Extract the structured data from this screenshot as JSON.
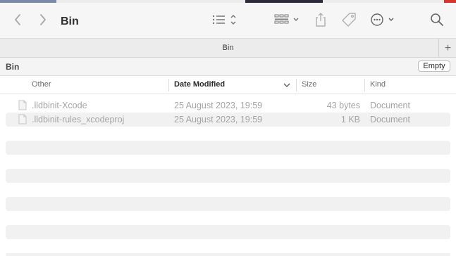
{
  "window": {
    "title": "Bin"
  },
  "tabbar": {
    "tab_label": "Bin",
    "new_tab": "+"
  },
  "pathbar": {
    "label": "Bin",
    "empty_button": "Empty"
  },
  "columns": {
    "name": "Other",
    "date": "Date Modified",
    "size": "Size",
    "kind": "Kind"
  },
  "files": [
    {
      "name": ".lldbinit-Xcode",
      "date": "25 August 2023, 19:59",
      "size": "43 bytes",
      "kind": "Document"
    },
    {
      "name": ".lldbinit-rules_xcodeproj",
      "date": "25 August 2023, 19:59",
      "size": "1 KB",
      "kind": "Document"
    }
  ],
  "icons": {
    "back": "chevron-left-icon",
    "forward": "chevron-right-icon",
    "view": "list-view-icon",
    "group": "group-grid-icon",
    "share": "share-icon",
    "tag": "tag-icon",
    "more": "ellipsis-circle-icon",
    "search": "search-icon",
    "file": "document-icon"
  }
}
